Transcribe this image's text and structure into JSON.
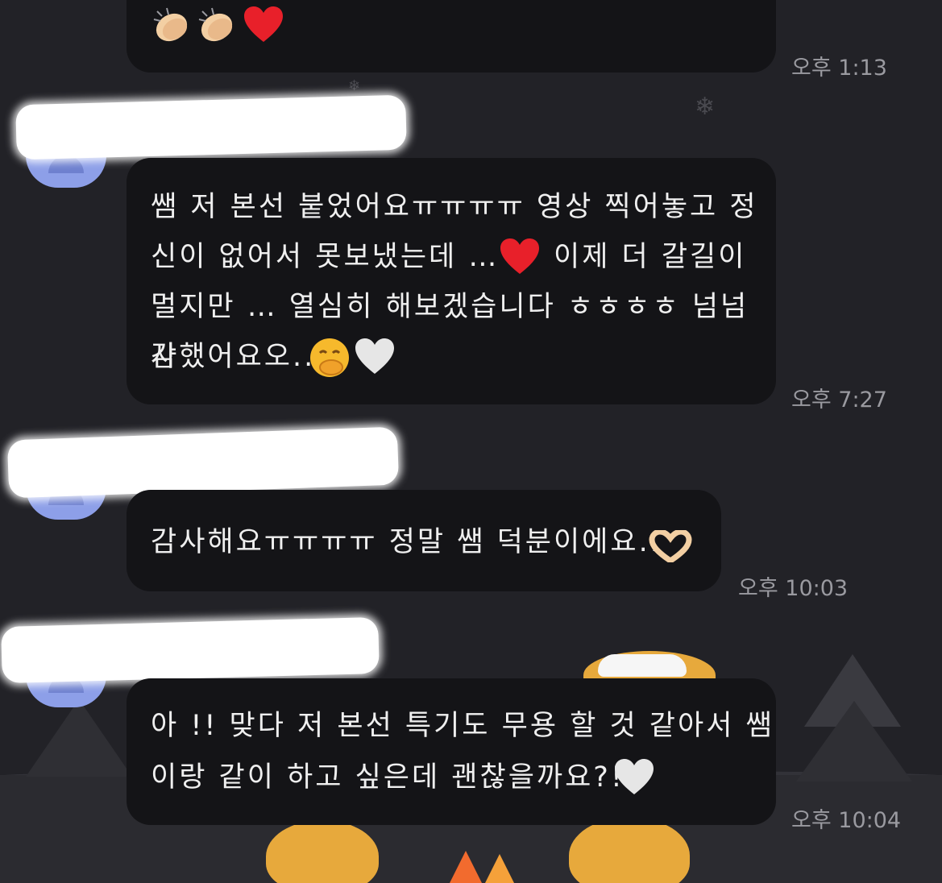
{
  "messages": [
    {
      "text": "",
      "emoji": [
        "clapping-hands",
        "clapping-hands",
        "red-heart"
      ],
      "time": "오후 1:13"
    },
    {
      "lines": [
        "쌤 저 본선 붙었어요ㅠㅠㅠㅠ 영상 찍어놓고 정",
        "신이 없어서 못보냈는데 …",
        "이제 더 갈길이",
        "멀지만 … 열심히 해보겠습니다 ㅎㅎㅎㅎ 넘넘 감",
        "사했어요오.."
      ],
      "emoji": [
        "red-heart",
        "face-with-hand-over-mouth",
        "white-heart"
      ],
      "time": "오후 7:27"
    },
    {
      "lines": [
        "감사해요ㅠㅠㅠㅠ 정말 쌤 덕분이에요.."
      ],
      "emoji": [
        "heart-hands"
      ],
      "time": "오후 10:03"
    },
    {
      "lines": [
        "아 !! 맞다 저 본선 특기도 무용 할 것 같아서 쌤",
        "이랑 같이 하고 싶은데 괜찮을까요?!"
      ],
      "emoji": [
        "white-heart"
      ],
      "time": "오후 10:04"
    }
  ],
  "colors": {
    "background": "#222227",
    "bubble": "#141417",
    "text": "#efefef",
    "timestamp": "#9a9aa0",
    "avatar": "#8d9fe8",
    "red_heart": "#e8202a",
    "white_heart": "#e6e6e6",
    "skin_emoji": "#f3cfa3",
    "bear": "#e7a93c",
    "fire": "#f26b2e"
  },
  "icons": {
    "snowflake": "snowflake-icon",
    "avatar": "profile-avatar"
  }
}
